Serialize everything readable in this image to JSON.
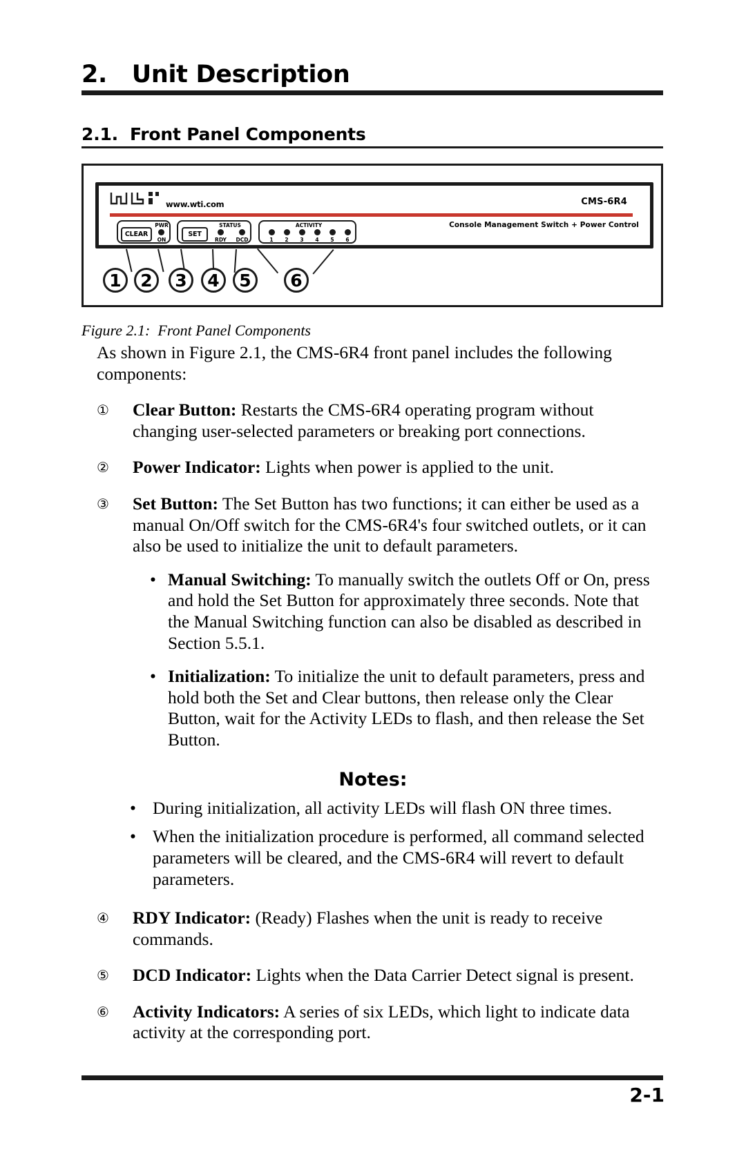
{
  "chapter": {
    "number": "2.",
    "title": "Unit Description",
    "heading": "2.   Unit Description"
  },
  "section": {
    "number": "2.1.",
    "title": "Front Panel Components",
    "heading": "2.1.  Front Panel Components"
  },
  "figure": {
    "caption": "Figure 2.1:  Front Panel Components",
    "panel": {
      "brand_logo": "wti-logo",
      "url": "www.wti.com",
      "model": "CMS-6R4",
      "description": "Console Management Switch + Power Control",
      "clear_button": "CLEAR",
      "set_button": "SET",
      "pwr_label": "PWR",
      "on_label": "ON",
      "status_label": "STATUS",
      "rdy_label": "RDY",
      "dcd_label": "DCD",
      "activity_label": "ACTIVITY",
      "activity_ports": [
        "1",
        "2",
        "3",
        "4",
        "5",
        "6"
      ],
      "accent_color": "#c8372d"
    },
    "callouts": [
      "1",
      "2",
      "3",
      "4",
      "5",
      "6"
    ]
  },
  "content": {
    "intro": "As shown in Figure 2.1, the CMS-6R4 front panel includes the following components:",
    "items": [
      {
        "num": "①",
        "title": "Clear Button:",
        "text": "  Restarts the CMS-6R4 operating program without changing user-selected parameters or breaking port connections."
      },
      {
        "num": "②",
        "title": "Power Indicator:",
        "text": "  Lights when power is applied to the unit."
      },
      {
        "num": "③",
        "title": "Set Button:",
        "text": "  The Set Button has two functions; it can either be used as a manual On/Off switch for the CMS-6R4's four switched outlets, or it can also be used to initialize the unit to default parameters."
      }
    ],
    "subitems": [
      {
        "bullet": "•",
        "title": "Manual Switching:",
        "text": "  To manually switch the outlets Off or On, press and hold the Set Button for approximately three seconds.  Note that the Manual Switching function can also be disabled as described in Section 5.5.1."
      },
      {
        "bullet": "•",
        "title": "Initialization:",
        "text": "  To initialize the unit to default parameters, press and hold both the Set and Clear buttons, then release only the Clear Button, wait for the Activity LEDs to flash, and then release the Set Button."
      }
    ],
    "notes_heading": "Notes:",
    "notes": [
      {
        "bullet": "•",
        "text": "During initialization, all activity LEDs will flash ON three times."
      },
      {
        "bullet": "•",
        "text": "When the initialization procedure is performed, all command selected parameters will be cleared, and the CMS-6R4 will revert to default parameters."
      }
    ],
    "items2": [
      {
        "num": "④",
        "title": "RDY Indicator:",
        "text": "  (Ready)  Flashes when the unit is ready to receive commands."
      },
      {
        "num": "⑤",
        "title": "DCD Indicator:",
        "text": "  Lights when the Data Carrier Detect signal is present."
      },
      {
        "num": "⑥",
        "title": "Activity Indicators:",
        "text": "  A series of six LEDs, which light to indicate data activity at the corresponding port."
      }
    ]
  },
  "footer": {
    "page_number": "2-1"
  }
}
